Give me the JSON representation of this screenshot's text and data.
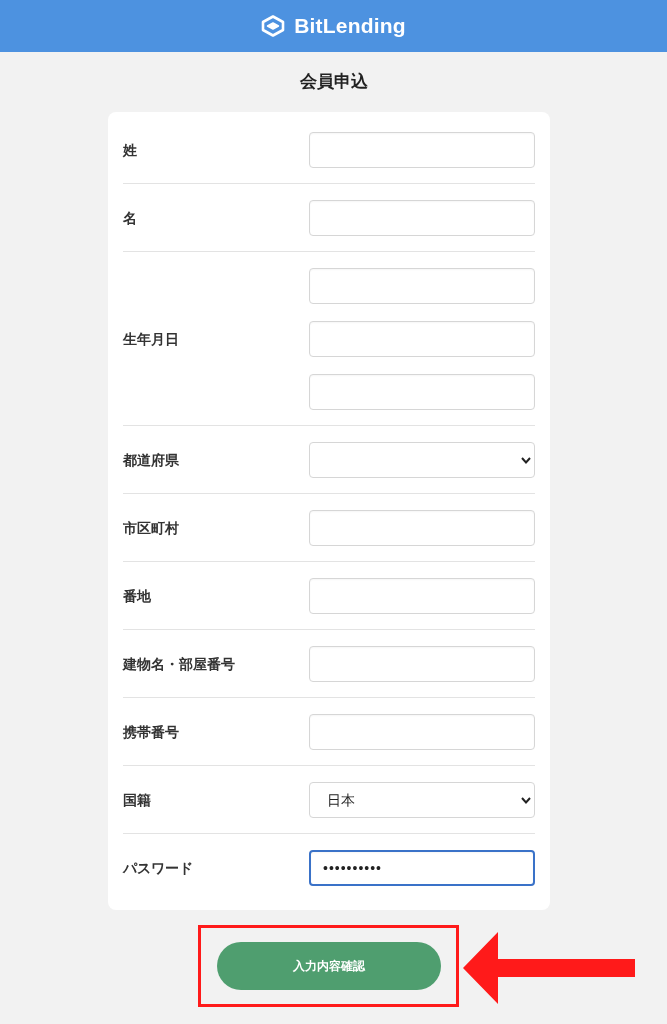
{
  "header": {
    "logo_text": "BitLending"
  },
  "page_title": "会員申込",
  "form": {
    "rows": [
      {
        "label": "姓",
        "fields": [
          {
            "kind": "text",
            "focused": false
          }
        ]
      },
      {
        "label": "名",
        "fields": [
          {
            "kind": "text",
            "focused": false
          }
        ]
      },
      {
        "label": "生年月日",
        "fields": [
          {
            "kind": "text",
            "focused": false
          },
          {
            "kind": "text",
            "focused": false
          },
          {
            "kind": "text",
            "focused": false
          }
        ]
      },
      {
        "label": "都道府県",
        "fields": [
          {
            "kind": "select",
            "focused": false
          }
        ]
      },
      {
        "label": "市区町村",
        "fields": [
          {
            "kind": "text",
            "focused": false
          }
        ]
      },
      {
        "label": "番地",
        "fields": [
          {
            "kind": "text",
            "focused": false
          }
        ]
      },
      {
        "label": "建物名・部屋番号",
        "fields": [
          {
            "kind": "text",
            "focused": false
          }
        ]
      },
      {
        "label": "携帯番号",
        "fields": [
          {
            "kind": "text",
            "focused": false
          }
        ]
      },
      {
        "label": "国籍",
        "fields": [
          {
            "kind": "select",
            "value": "日本",
            "focused": false
          }
        ]
      },
      {
        "label": "パスワード",
        "fields": [
          {
            "kind": "password",
            "value": "••••••••••",
            "focused": true
          }
        ]
      }
    ]
  },
  "submit_button": {
    "label": "入力内容確認",
    "highlighted": true
  }
}
